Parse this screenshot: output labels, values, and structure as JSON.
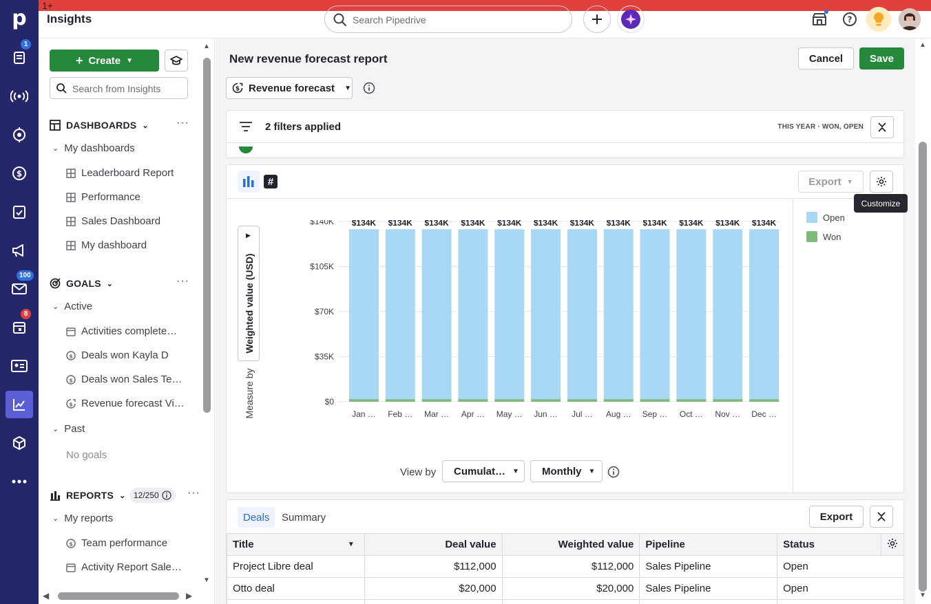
{
  "app": {
    "title": "Insights",
    "logo_letter": "p"
  },
  "rail": {
    "badges": {
      "deals": "1",
      "mail": "100",
      "calendar": "8"
    },
    "items": [
      "deals-icon",
      "leads-icon",
      "projects-icon",
      "revenue-icon",
      "tasks-icon",
      "campaigns-icon",
      "mail-icon",
      "calendar-icon",
      "contacts-icon",
      "insights-icon",
      "products-icon",
      "more-icon"
    ]
  },
  "header": {
    "search_placeholder": "Search Pipedrive",
    "notify_badge": "1+"
  },
  "sidebar": {
    "create_label": "Create",
    "search_placeholder": "Search from Insights",
    "dashboards": {
      "title": "DASHBOARDS",
      "group": "My dashboards",
      "items": [
        "Leaderboard Report",
        "Performance",
        "Sales Dashboard",
        "My dashboard"
      ]
    },
    "goals": {
      "title": "GOALS",
      "active_label": "Active",
      "active_items": [
        "Activities complete…",
        "Deals won Kayla D",
        "Deals won Sales Te…",
        "Revenue forecast Vi…"
      ],
      "past_label": "Past",
      "past_empty": "No goals"
    },
    "reports": {
      "title": "REPORTS",
      "count": "12/250",
      "group": "My reports",
      "items": [
        "Team performance",
        "Activity Report Sale…"
      ]
    }
  },
  "report": {
    "title": "New revenue forecast report",
    "cancel_label": "Cancel",
    "save_label": "Save",
    "type_label": "Revenue forecast",
    "filters_label": "2 filters applied",
    "filter_meta": "THIS YEAR · WON, OPEN",
    "export_label": "Export",
    "tooltip": "Customize",
    "view_by_label": "View by",
    "view_by_value": "Cumulat…",
    "interval_value": "Monthly",
    "measure_by_label": "Measure by",
    "measure_value": "Weighted value (USD)"
  },
  "chart_data": {
    "type": "bar",
    "stacked": true,
    "categories": [
      "Jan …",
      "Feb …",
      "Mar …",
      "Apr …",
      "May …",
      "Jun …",
      "Jul …",
      "Aug …",
      "Sep …",
      "Oct …",
      "Nov …",
      "Dec …"
    ],
    "data_labels": [
      "$134K",
      "$134K",
      "$134K",
      "$134K",
      "$134K",
      "$134K",
      "$134K",
      "$134K",
      "$134K",
      "$134K",
      "$134K",
      "$134K"
    ],
    "series": [
      {
        "name": "Won",
        "color": "#7fba7a",
        "values": [
          2,
          2,
          2,
          2,
          2,
          2,
          2,
          2,
          2,
          2,
          2,
          2
        ]
      },
      {
        "name": "Open",
        "color": "#a9d8f5",
        "values": [
          132,
          132,
          132,
          132,
          132,
          132,
          132,
          132,
          132,
          132,
          132,
          132
        ]
      }
    ],
    "y_ticks": [
      "$0",
      "$35K",
      "$70K",
      "$105K",
      "$140K"
    ],
    "y_tick_values": [
      0,
      35,
      70,
      105,
      140
    ],
    "ylim": [
      0,
      140
    ],
    "ylabel": "Weighted value (USD)",
    "legend": [
      "Open",
      "Won"
    ],
    "legend_position": "right",
    "grid": true
  },
  "table": {
    "tabs": [
      "Deals",
      "Summary"
    ],
    "export_label": "Export",
    "columns": [
      "Title",
      "Deal value",
      "Weighted value",
      "Pipeline",
      "Status"
    ],
    "rows": [
      [
        "Project Libre deal",
        "$112,000",
        "$112,000",
        "Sales Pipeline",
        "Open"
      ],
      [
        "Otto deal",
        "$20,000",
        "$20,000",
        "Sales Pipeline",
        "Open"
      ]
    ]
  }
}
